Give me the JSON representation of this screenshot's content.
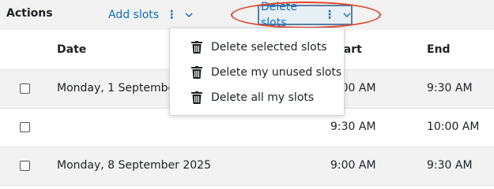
{
  "toolbar": {
    "actions_label": "Actions",
    "add_slots_label": "Add slots",
    "delete_slots_label": "Delete slots",
    "kebab_glyph": "⋮",
    "caret_glyph": "⌄"
  },
  "table": {
    "headers": {
      "date": "Date",
      "start": "Start",
      "end": "End"
    },
    "rows": [
      {
        "date": "Monday, 1 September 2025",
        "start": "9:00 AM",
        "end": "9:30 AM"
      },
      {
        "date": "",
        "start": "9:30 AM",
        "end": "10:00 AM"
      },
      {
        "date": "Monday, 8 September 2025",
        "start": "9:00 AM",
        "end": "9:30 AM"
      }
    ]
  },
  "delete_menu": {
    "items": [
      {
        "label": "Delete selected slots",
        "icon": "trash-icon"
      },
      {
        "label": "Delete my unused slots",
        "icon": "trash-icon"
      },
      {
        "label": "Delete all my slots",
        "icon": "trash-icon"
      }
    ]
  },
  "colors": {
    "link": "#0f6cbf",
    "highlight": "#e0452a"
  }
}
